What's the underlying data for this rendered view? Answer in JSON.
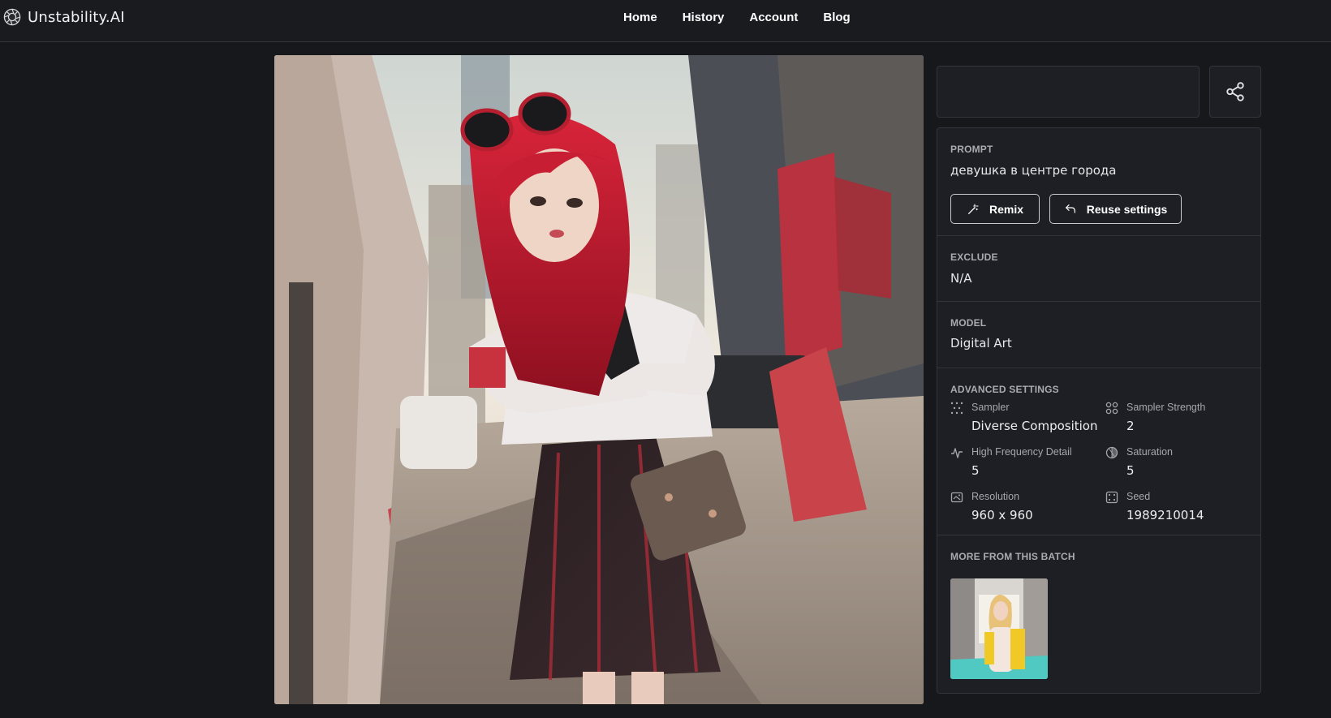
{
  "header": {
    "brand": "Unstability.AI",
    "nav": [
      "Home",
      "History",
      "Account",
      "Blog"
    ]
  },
  "image": {
    "description_icon": "generated-artwork"
  },
  "title_box": {
    "value": ""
  },
  "prompt": {
    "label": "PROMPT",
    "value": "девушка в центре города",
    "remix_label": "Remix",
    "reuse_label": "Reuse settings"
  },
  "exclude": {
    "label": "EXCLUDE",
    "value": "N/A"
  },
  "model": {
    "label": "MODEL",
    "value": "Digital Art"
  },
  "advanced": {
    "label": "ADVANCED SETTINGS",
    "settings": [
      {
        "label": "Sampler",
        "value": "Diverse Composition",
        "icon": "sampler-icon"
      },
      {
        "label": "Sampler Strength",
        "value": "2",
        "icon": "sampler-strength-icon"
      },
      {
        "label": "High Frequency Detail",
        "value": "5",
        "icon": "high-frequency-icon"
      },
      {
        "label": "Saturation",
        "value": "5",
        "icon": "saturation-icon"
      },
      {
        "label": "Resolution",
        "value": "960 x 960",
        "icon": "resolution-icon"
      },
      {
        "label": "Seed",
        "value": "1989210014",
        "icon": "seed-icon"
      }
    ]
  },
  "batch": {
    "label": "MORE FROM THIS BATCH"
  },
  "colors": {
    "background": "#17181c",
    "panel": "#1e1f24",
    "border": "#33353c",
    "label": "#a9abb2"
  }
}
